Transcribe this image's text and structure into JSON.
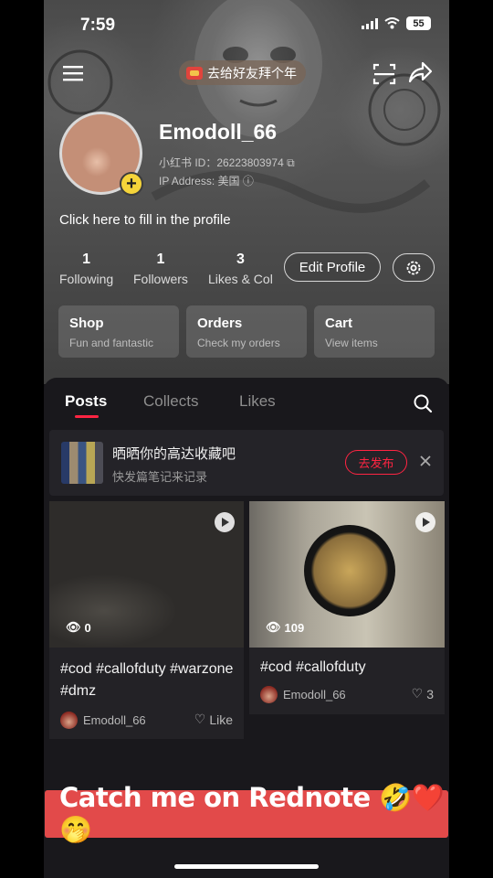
{
  "status_bar": {
    "time": "7:59",
    "battery": "55"
  },
  "header": {
    "new_year_pill": "去给好友拜个年"
  },
  "profile": {
    "username": "Emodoll_66",
    "id_line": "小红书 ID：26223803974",
    "ip_line": "IP Address: 美国",
    "bio_placeholder": "Click here to fill in the profile",
    "avatar_add": "+"
  },
  "stats": [
    {
      "value": "1",
      "label": "Following"
    },
    {
      "value": "1",
      "label": "Followers"
    },
    {
      "value": "3",
      "label": "Likes & Col"
    }
  ],
  "actions": {
    "edit_profile": "Edit Profile"
  },
  "shortcuts": [
    {
      "title": "Shop",
      "subtitle": "Fun and fantastic"
    },
    {
      "title": "Orders",
      "subtitle": "Check my orders"
    },
    {
      "title": "Cart",
      "subtitle": "View items"
    }
  ],
  "tabs": [
    {
      "label": "Posts",
      "active": true
    },
    {
      "label": "Collects",
      "active": false
    },
    {
      "label": "Likes",
      "active": false
    }
  ],
  "promo": {
    "title": "晒晒你的高达收藏吧",
    "subtitle": "快发篇笔记来记录",
    "button": "去发布"
  },
  "posts": [
    {
      "views": "0",
      "title": "#cod #callofduty #warzone #dmz",
      "author": "Emodoll_66",
      "likes": "Like"
    },
    {
      "views": "109",
      "title": "#cod #callofduty",
      "author": "Emodoll_66",
      "likes": "3"
    }
  ],
  "caption_banner": "Catch me on Rednote 🤣❤️🤭",
  "colors": {
    "accent": "#ff2442",
    "banner": "#e24a4a",
    "pill_yellow": "#f5d43a"
  }
}
